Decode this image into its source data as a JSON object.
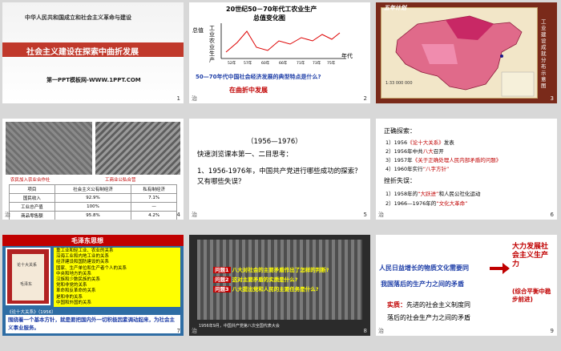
{
  "slides": [
    {
      "id": 1,
      "number": "1",
      "tag": "",
      "subtitle": "中华人民共和国成立和社会主义革命与建设",
      "title": "社会主义建设在探索中曲折发展",
      "footer": "第一PPT模板网-WWW.1PPT.COM"
    },
    {
      "id": 2,
      "number": "2",
      "tag": "治",
      "title_line1": "20世纪50－70年代工农业生产",
      "title_line2": "总值变化图",
      "ylabel": "总值",
      "ylabel2": "工业",
      "ylabel3": "农业",
      "ylabel4": "生产",
      "xlabel": "年代",
      "question": "50—70年代中国社会经济发展的典型特点是什么?",
      "answer": "在曲折中发展"
    },
    {
      "id": 3,
      "number": "3",
      "tag": "",
      "banner": "五年计划",
      "side_text": "工业建设成就分布示意图",
      "map_footer": "1:33 000 000"
    },
    {
      "id": 4,
      "number": "4",
      "tag": "治",
      "caption_left": "农民加入农业合作社",
      "caption_right": "工商业公私合营",
      "table": {
        "headers": [
          "项目",
          "社会主义公有制经济",
          "私有制经济"
        ],
        "rows": [
          [
            "国民收入",
            "92.9%",
            "7.1%"
          ],
          [
            "工业总产值",
            "100%",
            "—"
          ],
          [
            "商品零售额",
            "95.8%",
            "4.2%"
          ]
        ]
      }
    },
    {
      "id": 5,
      "number": "5",
      "tag": "治",
      "years": "（1956—1976）",
      "instruction": "快速浏览课本第一、二目思考：",
      "question": "1、1956-1976年，中国共产党进行哪些成功的探索？又有哪些失误？"
    },
    {
      "id": 6,
      "number": "6",
      "tag": "治",
      "heading": "正确探索：",
      "correct": [
        {
          "prefix": "1）1956",
          "quote": "《论十大关系》",
          "suffix": "发表"
        },
        {
          "prefix": "2）1956年中共",
          "quote": "八大",
          "suffix": "召开"
        },
        {
          "prefix": "3）1957年",
          "quote": "《关于正确处理人民内部矛盾的问题》",
          "suffix": ""
        },
        {
          "prefix": "4）1960年实行",
          "quote": "“八字方针”",
          "suffix": ""
        }
      ],
      "heading2": "挫折失误：",
      "mistakes": [
        {
          "prefix": "1）1958年的",
          "quote": "“大跃进”",
          "suffix": "和人民公社化运动"
        },
        {
          "prefix": "2）1966—1976年的",
          "quote": "“文化大革命”",
          "suffix": ""
        }
      ]
    },
    {
      "id": 7,
      "number": "7",
      "tag": "",
      "banner": "毛泽东思想",
      "book_title": "论十大关系",
      "book_author": "毛泽东",
      "relations": [
        "重工业和轻工业、农业的关系",
        "沿海工业和内地工业的关系",
        "经济建设和国防建设的关系",
        "国家、生产单位和生产者个人的关系",
        "中央和地方的关系",
        "汉族和少数民族的关系",
        "党和非党的关系",
        "革命和反革命的关系",
        "是和非的关系",
        "中国和外国的关系"
      ],
      "caption": "《论十大关系》（1956）",
      "footer": "围绕着一个基本方针，就是要把国内外一切积极因素调动起来，为社会主义事业服务。"
    },
    {
      "id": 8,
      "number": "8",
      "tag": "治",
      "q1": "八大对社会的主要矛盾作出了怎样的判断?",
      "q2": "这对主要矛盾的实质是什么?",
      "q3": "八大提出党和人民的主要任务是什么?",
      "q1_label": "问题1",
      "q2_label": "问题2",
      "q3_label": "问题3",
      "bottom": "1956年9月，中国共产党第八次全国代表大会"
    },
    {
      "id": 9,
      "number": "9",
      "tag": "治",
      "line1a": "人民日益增长的物质文化需要",
      "line1b": "同",
      "line2": "我国落后的生产力之间的矛盾",
      "essence_label": "实质：",
      "essence": "先进的社会主义制度同",
      "essence2": "落后的社会生产力之间的矛盾",
      "right": "大力发展社会主义生产力",
      "right2": "(综合平衡中稳步前进)"
    }
  ],
  "colors": {
    "red": "#c00000",
    "blue": "#1f3fa8",
    "orange": "#e36c09",
    "yellow": "#ffff00"
  }
}
